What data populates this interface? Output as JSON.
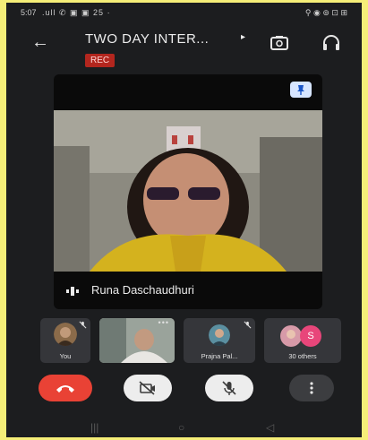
{
  "status_bar": {
    "time": "5:07",
    "signal": ".ull ✆ ▣ ▣ 25 ·",
    "right_icons": "⚲ ◉ ⊚ ⊡ ⊞"
  },
  "meeting": {
    "title": "TWO DAY INTER...",
    "recording_badge": "REC"
  },
  "main_tile": {
    "speaker_name": "Runa Daschaudhuri"
  },
  "participants": [
    {
      "label": "You"
    },
    {
      "label": ""
    },
    {
      "label": "Prajna Pal..."
    },
    {
      "label": "30 others",
      "avatar_initial": "S"
    }
  ],
  "colors": {
    "end_call": "#e94235",
    "rec_badge": "#b3261e",
    "page_bg": "#f5ee78",
    "app_bg": "#1c1d1f"
  }
}
